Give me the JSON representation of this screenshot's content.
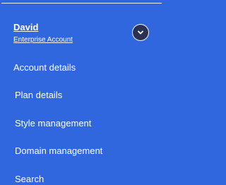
{
  "account": {
    "name": "David",
    "type": "Enterprise Account"
  },
  "menu": {
    "items": [
      {
        "label": "Account details"
      },
      {
        "label": "Plan details"
      },
      {
        "label": "Style management"
      },
      {
        "label": "Domain management"
      },
      {
        "label": "Search"
      }
    ]
  },
  "icons": {
    "toggle": "chevron-down-icon"
  },
  "colors": {
    "background": "#3067df",
    "text": "#ffffff",
    "toggle_bg": "#2a3155"
  }
}
